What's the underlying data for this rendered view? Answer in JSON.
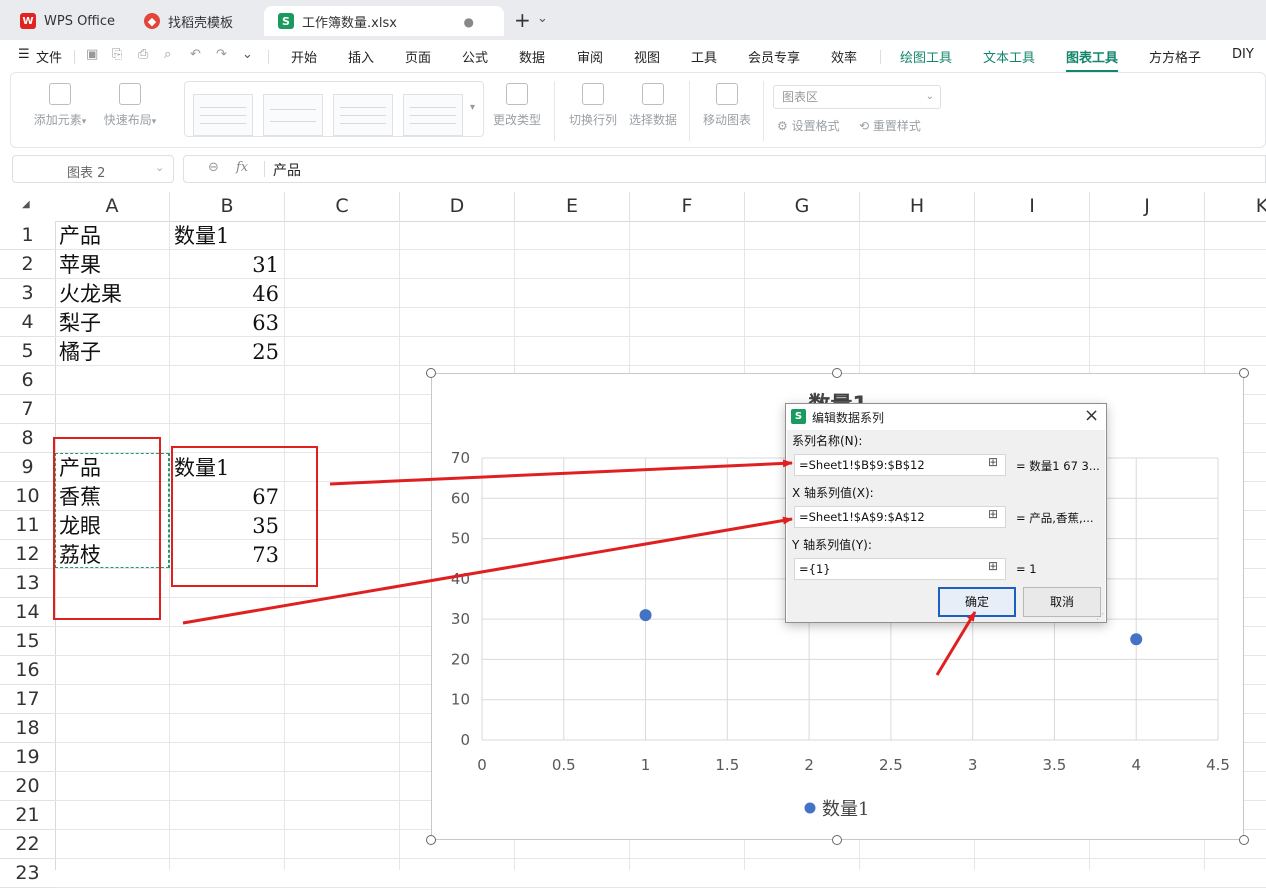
{
  "tabs": [
    {
      "label": "WPS Office",
      "icon": "wps-logo-icon"
    },
    {
      "label": "找稻壳模板",
      "icon": "docer-icon"
    },
    {
      "label": "工作簿数量.xlsx",
      "icon": "spreadsheet-s-icon",
      "glyph": "S",
      "modified_dot": "●",
      "close": "×"
    }
  ],
  "new_tab": "+",
  "tab_menu": "⌄",
  "menubar": {
    "file_label": "文件",
    "items": [
      "开始",
      "插入",
      "页面",
      "公式",
      "数据",
      "审阅",
      "视图",
      "工具",
      "会员专享",
      "效率"
    ],
    "context_items": [
      "绘图工具",
      "文本工具",
      "图表工具",
      "方方格子",
      "DIY"
    ],
    "selected": "图表工具"
  },
  "ribbon": {
    "add_element": "添加元素",
    "quick_layout": "快速布局",
    "change_type": "更改类型",
    "switch_rowcol": "切换行列",
    "select_data": "选择数据",
    "move_chart": "移动图表",
    "chart_area_select": "图表区",
    "set_format": "设置格式",
    "reset_style": "重置样式"
  },
  "formula_bar": {
    "name_box": "图表 2",
    "fx": "fx",
    "content": "产品"
  },
  "grid": {
    "columns": [
      "A",
      "B",
      "C",
      "D",
      "E",
      "F",
      "G",
      "H",
      "I",
      "J",
      "K"
    ],
    "rows": [
      "1",
      "2",
      "3",
      "4",
      "5",
      "6",
      "7",
      "8",
      "9",
      "10",
      "11",
      "12",
      "13",
      "14",
      "15",
      "16",
      "17",
      "18",
      "19",
      "20",
      "21",
      "22",
      "23"
    ],
    "cells": {
      "A1": "产品",
      "B1": "数量1",
      "A2": "苹果",
      "B2": "31",
      "A3": "火龙果",
      "B3": "46",
      "A4": "梨子",
      "B4": "63",
      "A5": "橘子",
      "B5": "25",
      "A9": "产品",
      "B9": "数量1",
      "A10": "香蕉",
      "B10": "67",
      "A11": "龙眼",
      "B11": "35",
      "A12": "荔枝",
      "B12": "73"
    }
  },
  "chart_data": {
    "type": "scatter",
    "title": "数量1",
    "xlim": [
      0,
      4.5
    ],
    "ylim": [
      0,
      70
    ],
    "x_ticks": [
      "0",
      "0.5",
      "1",
      "1.5",
      "2",
      "2.5",
      "3",
      "3.5",
      "4",
      "4.5"
    ],
    "y_ticks": [
      "0",
      "10",
      "20",
      "30",
      "40",
      "50",
      "60",
      "70"
    ],
    "grid": true,
    "legend_position": "bottom",
    "series": [
      {
        "name": "数量1",
        "color": "#4472c4",
        "x": [
          1,
          2,
          3,
          4
        ],
        "y": [
          31,
          46,
          63,
          25
        ]
      }
    ]
  },
  "dialog": {
    "icon": "S",
    "title": "编辑数据系列",
    "close": "×",
    "series_name_label": "系列名称(N):",
    "series_name_value": "=Sheet1!$B$9:$B$12",
    "series_name_preview": "= 数量1 67 3...",
    "x_label": "X 轴系列值(X):",
    "x_value": "=Sheet1!$A$9:$A$12",
    "x_preview": "= 产品,香蕉,...",
    "y_label": "Y 轴系列值(Y):",
    "y_value": "={1}",
    "y_preview": "= 1",
    "ok": "确定",
    "cancel": "取消"
  },
  "colors": {
    "accent": "#14866d",
    "annotation_red": "#e02020",
    "selection_green": "#1f9a6e",
    "series_blue": "#4472c4"
  }
}
